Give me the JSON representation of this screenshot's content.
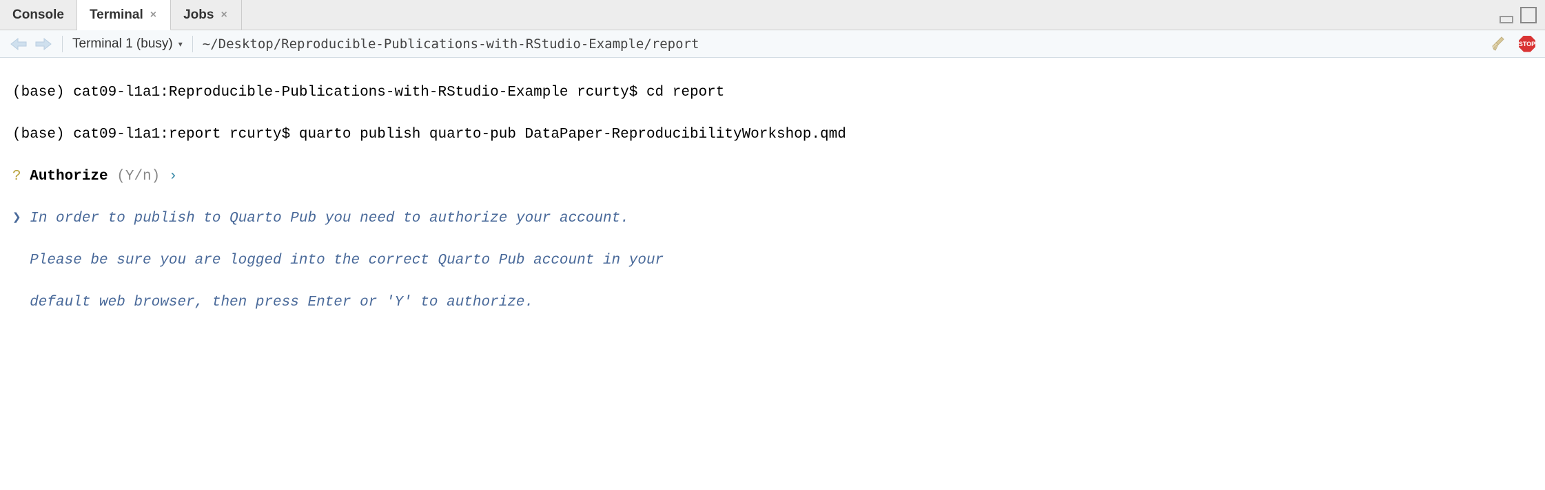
{
  "tabs": {
    "console": "Console",
    "terminal": "Terminal",
    "jobs": "Jobs"
  },
  "toolbar": {
    "terminal_label": "Terminal 1 (busy)",
    "path": "~/Desktop/Reproducible-Publications-with-RStudio-Example/report",
    "stop_label": "STOP"
  },
  "terminal": {
    "line1": "(base) cat09-l1a1:Reproducible-Publications-with-RStudio-Example rcurty$ cd report",
    "line2": "(base) cat09-l1a1:report rcurty$ quarto publish quarto-pub DataPaper-ReproducibilityWorkshop.qmd",
    "auth_q": "?",
    "auth_label": " Authorize ",
    "auth_yn": "(Y/n)",
    "auth_caret": " ›",
    "info_caret": "❯ ",
    "info1": "In order to publish to Quarto Pub you need to authorize your account.",
    "info2": "  Please be sure you are logged into the correct Quarto Pub account in your",
    "info3": "  default web browser, then press Enter or 'Y' to authorize."
  }
}
